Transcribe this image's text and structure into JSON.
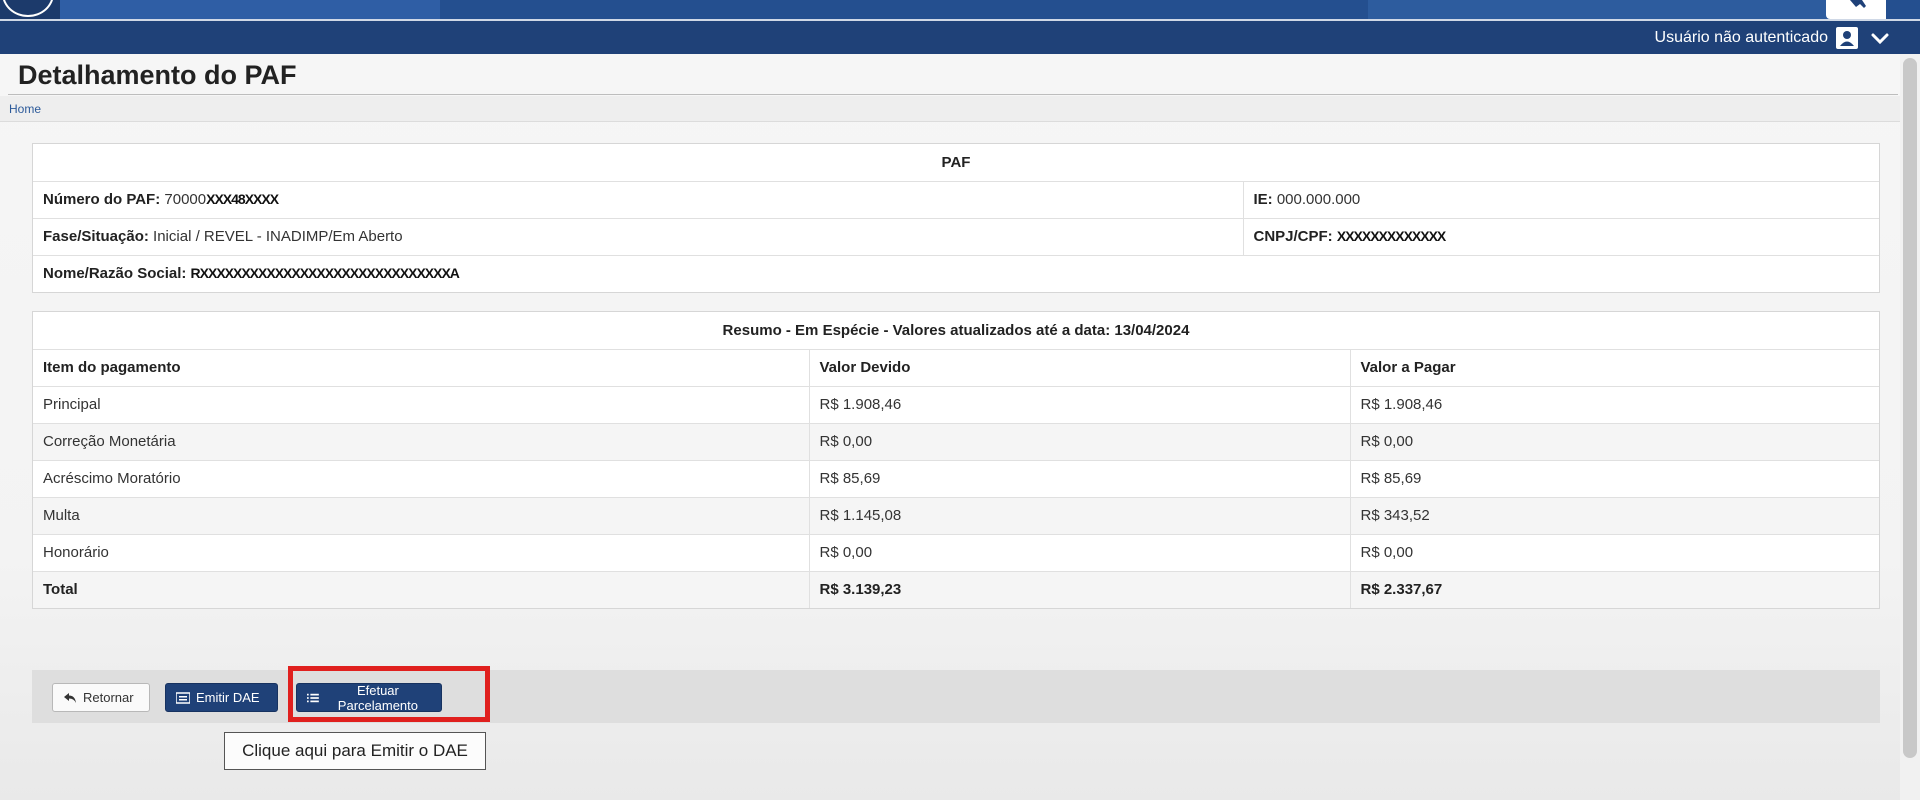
{
  "header": {
    "user_label": "Usuário não autenticado"
  },
  "page": {
    "title": "Detalhamento do PAF",
    "breadcrumb_home": "Home"
  },
  "paf": {
    "heading": "PAF",
    "numero_label": "Número do PAF:",
    "numero_value": "70000",
    "numero_masked": "XXX48XXXX",
    "ie_label": "IE:",
    "ie_value": "000.000.000",
    "fase_label": "Fase/Situação:",
    "fase_value": "Inicial / REVEL - INADIMP/Em Aberto",
    "cnpj_label": "CNPJ/CPF:",
    "cnpj_masked": "XXXXXXXXXXXXX",
    "nome_label": "Nome/Razão Social:",
    "nome_masked": "RXXXXXXXXXXXXXXXXXXXXXXXXXXXXXXA"
  },
  "resumo": {
    "heading": "Resumo - Em Espécie - Valores atualizados até a data: 13/04/2024",
    "columns": [
      "Item do pagamento",
      "Valor Devido",
      "Valor a Pagar"
    ],
    "rows": [
      [
        "Principal",
        "R$ 1.908,46",
        "R$ 1.908,46"
      ],
      [
        "Correção Monetária",
        "R$ 0,00",
        "R$ 0,00"
      ],
      [
        "Acréscimo Moratório",
        "R$ 85,69",
        "R$ 85,69"
      ],
      [
        "Multa",
        "R$ 1.145,08",
        "R$ 343,52"
      ],
      [
        "Honorário",
        "R$ 0,00",
        "R$ 0,00"
      ]
    ],
    "total": [
      "Total",
      "R$ 3.139,23",
      "R$ 2.337,67"
    ]
  },
  "actions": {
    "retornar": "Retornar",
    "emitir_dae": "Emitir DAE",
    "efetuar_parcelamento": "Efetuar Parcelamento"
  },
  "tooltip": "Clique aqui para Emitir o DAE",
  "colors": {
    "header_dark": "#1f4178",
    "highlight": "#e0201e"
  },
  "icons": {
    "user": "user-icon",
    "chevron": "chevron-down-icon",
    "back": "reply-arrow-icon",
    "dae": "list-card-icon",
    "parcelamento": "list-icon"
  }
}
